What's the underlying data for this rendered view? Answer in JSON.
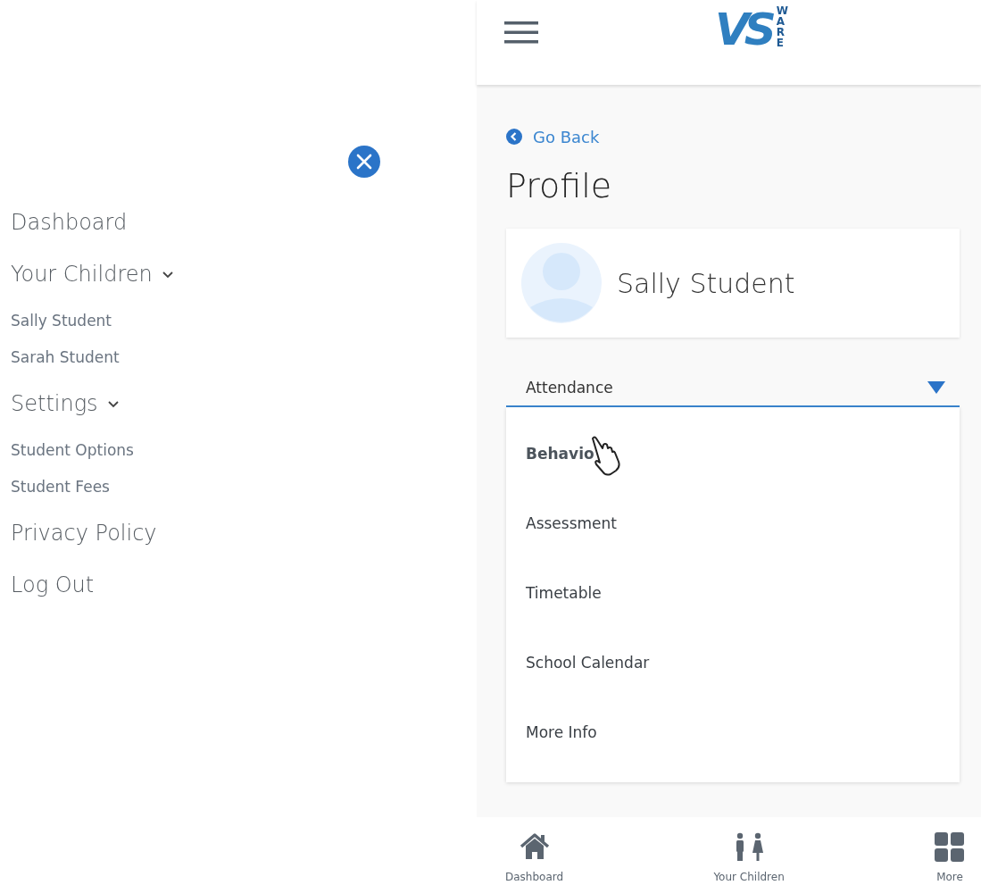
{
  "menu": {
    "close_button": true,
    "items": [
      {
        "label": "Dashboard"
      },
      {
        "label": "Your Children",
        "expanded": true,
        "children": [
          {
            "label": "Sally Student"
          },
          {
            "label": "Sarah Student"
          }
        ]
      },
      {
        "label": "Settings",
        "expanded": true,
        "children": [
          {
            "label": "Student Options"
          },
          {
            "label": "Student Fees"
          }
        ]
      },
      {
        "label": "Privacy Policy"
      },
      {
        "label": "Log Out"
      }
    ]
  },
  "header": {
    "logo": {
      "mark": "VS",
      "word": "WARE"
    }
  },
  "page": {
    "back_link": "Go Back",
    "title": "Profile",
    "profile": {
      "name": "Sally Student"
    },
    "select": {
      "value": "Attendance",
      "expanded": true,
      "options": [
        {
          "label": "Behavio",
          "highlighted": true
        },
        {
          "label": "Assessment",
          "highlighted": false
        },
        {
          "label": "Timetable",
          "highlighted": false
        },
        {
          "label": "School Calendar",
          "highlighted": false
        },
        {
          "label": "More Info",
          "highlighted": false
        }
      ]
    }
  },
  "bottom_nav": [
    {
      "kind": "home",
      "label": "Dashboard"
    },
    {
      "kind": "people",
      "label": "Your Children"
    },
    {
      "kind": "grid",
      "label": "More"
    }
  ]
}
